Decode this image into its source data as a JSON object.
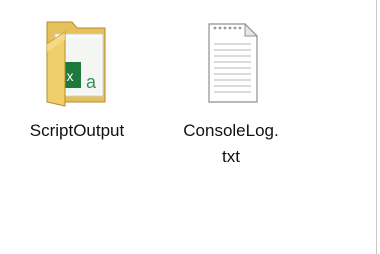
{
  "files": [
    {
      "name": "ScriptOutput",
      "icon": "folder-icon",
      "badge_left": "x",
      "badge_right": "a",
      "colors": {
        "folder": "#e9c45a",
        "badge_green": "#1d7a3a"
      }
    },
    {
      "name": "ConsoleLog.txt",
      "icon": "text-file-icon"
    }
  ]
}
